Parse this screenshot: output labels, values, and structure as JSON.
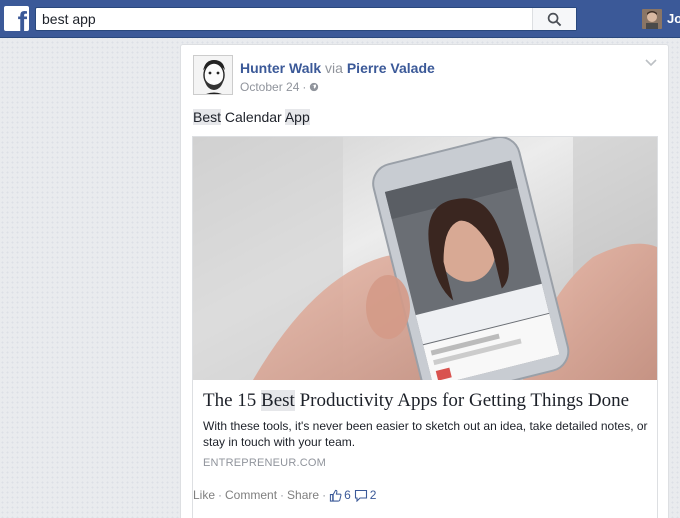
{
  "search": {
    "query": "best app"
  },
  "top_nav": {
    "user_label": "Jo"
  },
  "post": {
    "author": "Hunter Walk",
    "via_word": "via",
    "via_author": "Pierre Valade",
    "date": "October 24",
    "dot": "·",
    "text_parts": [
      "Best",
      " Calendar ",
      "App"
    ],
    "link": {
      "title_before": "The 15 ",
      "title_highlight": "Best",
      "title_after": " Productivity Apps for Getting Things Done",
      "description": "With these tools, it's never been easier to sketch out an idea, take detailed notes, or stay in touch with your team.",
      "domain": "ENTREPRENEUR.COM"
    },
    "actions": {
      "like": "Like",
      "comment": "Comment",
      "share": "Share",
      "separator": "·",
      "like_count": "6",
      "comment_count": "2"
    }
  },
  "colors": {
    "brand": "#3b5998",
    "page_bg": "#e9ebee",
    "meta_text": "#90949c"
  },
  "icons": [
    "facebook-logo",
    "search-icon",
    "globe-icon",
    "chevron-down-icon",
    "thumbs-up-icon",
    "comment-bubble-icon"
  ]
}
